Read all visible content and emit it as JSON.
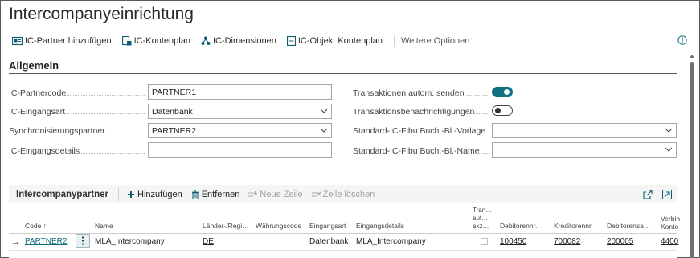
{
  "page": {
    "title": "Intercompanyeinrichtung"
  },
  "actions": [
    {
      "label": "IC-Partner hinzufügen",
      "icon": "ic-partner-icon"
    },
    {
      "label": "IC-Kontenplan",
      "icon": "chart-of-accounts-icon"
    },
    {
      "label": "IC-Dimensionen",
      "icon": "dimensions-icon"
    },
    {
      "label": "IC-Objekt Kontenplan",
      "icon": "object-chart-icon"
    },
    {
      "label": "Weitere Optionen",
      "icon": ""
    }
  ],
  "section": {
    "title": "Allgemein"
  },
  "fields_left": [
    {
      "label": "IC-Partnercode",
      "value": "PARTNER1",
      "type": "text"
    },
    {
      "label": "IC-Eingangsart",
      "value": "Datenbank",
      "type": "select"
    },
    {
      "label": "Synchronisierungspartner",
      "value": "PARTNER2",
      "type": "select"
    },
    {
      "label": "IC-Eingangsdetails",
      "value": "",
      "type": "text"
    }
  ],
  "fields_right": [
    {
      "label": "Transaktionen autom. senden",
      "value": true,
      "type": "toggle"
    },
    {
      "label": "Transaktionsbenachrichtigungen",
      "value": false,
      "type": "toggle"
    },
    {
      "label": "Standard-IC-Fibu Buch.-Bl.-Vorlage",
      "value": "",
      "type": "select"
    },
    {
      "label": "Standard-IC-Fibu Buch.-Bl.-Name",
      "value": "",
      "type": "select"
    }
  ],
  "subpage": {
    "title": "Intercompanypartner",
    "actions": [
      {
        "label": "Hinzufügen",
        "enabled": true
      },
      {
        "label": "Entfernen",
        "enabled": true
      },
      {
        "label": "Neue Zeile",
        "enabled": false
      },
      {
        "label": "Zeile löschen",
        "enabled": false
      }
    ],
    "columns": {
      "code": "Code ↑",
      "name": "Name",
      "country": "Länder-/Regi…",
      "currency": "Währungscode",
      "inbox_type": "Eingangsart",
      "inbox_details": "Eingangsdetails",
      "trans_line1": "Tran…",
      "trans_line2": "aut…",
      "trans_line3": "akz…",
      "debitor": "Debitorennr.",
      "kreditor": "Kreditorennr.",
      "debitorsa": "Debitorensa…",
      "verbind1": "Verbin",
      "verbind2": "Konto"
    },
    "rows": [
      {
        "code": "PARTNER2",
        "name": "MLA_Intercompany",
        "country": "DE",
        "currency": "",
        "inbox_type": "Datenbank",
        "inbox_details": "MLA_Intercompany",
        "auto_accept": false,
        "debitor": "100450",
        "kreditor": "700082",
        "debitorsa": "200005",
        "verbind": "4400"
      }
    ]
  },
  "colors": {
    "accent": "#0f7082",
    "link": "#0e6a7b"
  }
}
